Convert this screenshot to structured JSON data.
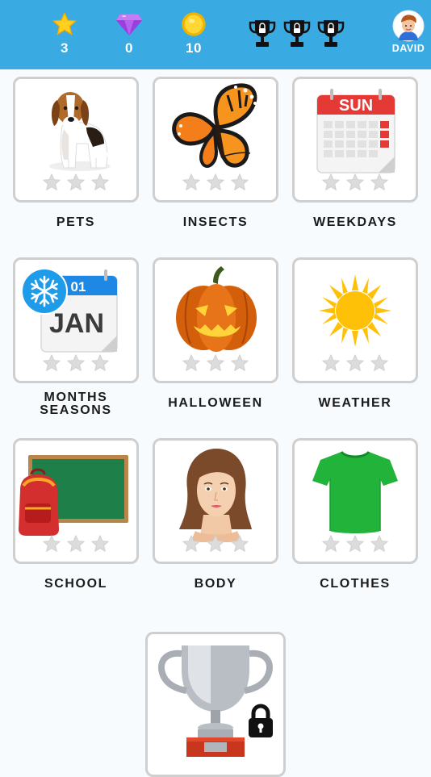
{
  "header": {
    "stars": {
      "icon": "star-icon",
      "count": "3"
    },
    "gems": {
      "icon": "diamond-icon",
      "count": "0"
    },
    "coins": {
      "icon": "coin-icon",
      "count": "10"
    },
    "trophies": [
      {
        "icon": "trophy-locked-icon"
      },
      {
        "icon": "trophy-locked-icon"
      },
      {
        "icon": "trophy-locked-icon"
      }
    ],
    "user": {
      "name": "DAVID",
      "icon": "avatar"
    }
  },
  "categories": [
    {
      "label": "PETS",
      "icon": "beagle-dog-image",
      "stars_earned": 0,
      "stars_total": 3
    },
    {
      "label": "INSECTS",
      "icon": "butterfly-image",
      "stars_earned": 0,
      "stars_total": 3
    },
    {
      "label": "WEEKDAYS",
      "icon": "calendar-sun-image",
      "calendar_text": "SUN",
      "stars_earned": 0,
      "stars_total": 3
    },
    {
      "label_line1": "MONTHS",
      "label_line2": "SEASONS",
      "icon": "calendar-jan-image",
      "calendar_day": "01",
      "calendar_month": "JAN",
      "badge_icon": "snowflake-icon",
      "stars_earned": 0,
      "stars_total": 3
    },
    {
      "label": "HALLOWEEN",
      "icon": "jack-o-lantern-image",
      "stars_earned": 0,
      "stars_total": 3
    },
    {
      "label": "WEATHER",
      "icon": "sun-image",
      "stars_earned": 0,
      "stars_total": 3
    },
    {
      "label": "SCHOOL",
      "icon": "chalkboard-backpack-image",
      "stars_earned": 0,
      "stars_total": 3
    },
    {
      "label": "BODY",
      "icon": "woman-face-image",
      "stars_earned": 0,
      "stars_total": 3
    },
    {
      "label": "CLOTHES",
      "icon": "green-tshirt-image",
      "stars_earned": 0,
      "stars_total": 3
    }
  ],
  "locked_reward": {
    "icon": "silver-trophy-image",
    "lock_icon": "padlock-icon"
  },
  "colors": {
    "topbar": "#3aaae3",
    "star_empty": "#d9d9d9",
    "card_border": "#cfcfcf"
  }
}
